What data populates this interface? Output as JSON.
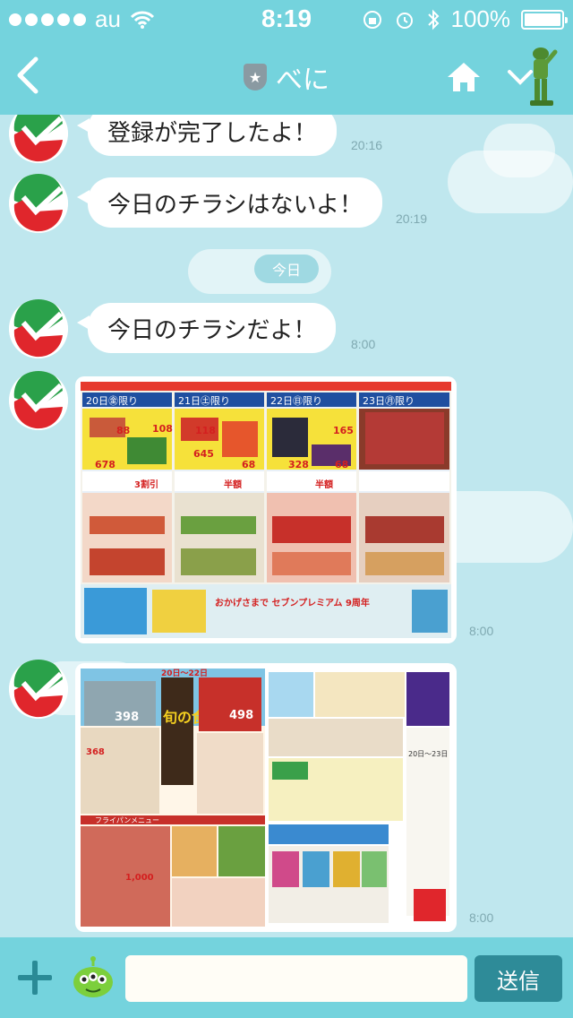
{
  "status_bar": {
    "carrier": "au",
    "time": "8:19",
    "battery": "100%"
  },
  "nav": {
    "title": "べに"
  },
  "chat": {
    "date_separator": "今日",
    "messages": [
      {
        "text": "登録が完了したよ！",
        "time": "20:16"
      },
      {
        "text": "今日のチラシはないよ！",
        "time": "20:19"
      },
      {
        "text": "今日のチラシだよ！",
        "time": "8:00"
      },
      {
        "image": "flyer-1",
        "time": "8:00"
      },
      {
        "image": "flyer-2",
        "time": "8:00"
      }
    ]
  },
  "flyer1": {
    "header": "おかげさまで セブンプレミアム 9周年",
    "days": [
      {
        "label": "20日㊎限り"
      },
      {
        "label": "21日㊏限り"
      },
      {
        "label": "22日㊐限り"
      },
      {
        "label": "23日㊊限り"
      }
    ],
    "prices": [
      "88",
      "108",
      "678",
      "118",
      "645",
      "68",
      "165",
      "328",
      "68",
      "3割引",
      "半額",
      "半額"
    ]
  },
  "flyer2": {
    "dates": "20日〜22日",
    "headline": "旬の食材",
    "prices": [
      "398",
      "498",
      "368",
      "1,000"
    ],
    "section": "フライパンメニュー",
    "sale": "20日〜23日"
  },
  "input": {
    "placeholder": "",
    "send_label": "送信"
  },
  "colors": {
    "header": "#74d3dd",
    "background": "#bfe7ee",
    "send_button": "#2e8b98",
    "brand_red": "#e0262c",
    "brand_green": "#2aa14a"
  }
}
